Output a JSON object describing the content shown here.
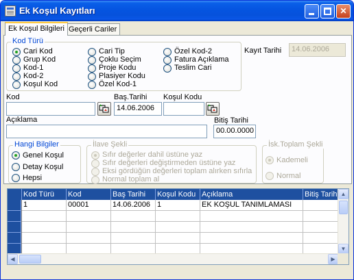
{
  "window": {
    "title": "Ek Koşul Kayıtları",
    "app_icon": "form-icon"
  },
  "tabs": [
    "Ek Koşul Bilgileri",
    "Geçerli Cariler"
  ],
  "kod_turu": {
    "title": "Kod Türü",
    "options": [
      "Cari Kod",
      "Grup Kod",
      "Kod-1",
      "Kod-2",
      "Koşul Kod",
      "Cari Tip",
      "Çoklu Seçim",
      "Proje Kodu",
      "Plasiyer Kodu",
      "Özel Kod-1",
      "Özel Kod-2",
      "Fatura Açıklama",
      "Teslim Cari"
    ],
    "selected": "Cari Kod"
  },
  "kayit_tarihi": {
    "label": "Kayıt Tarihi",
    "value": "14.06.2006"
  },
  "kod": {
    "label": "Kod",
    "value": ""
  },
  "bas_tarihi": {
    "label": "Baş.Tarihi",
    "value": "14.06.2006"
  },
  "kosul_kodu": {
    "label": "Koşul Kodu",
    "value": ""
  },
  "aciklama": {
    "label": "Açıklama",
    "value": ""
  },
  "bitis_tarihi": {
    "label": "Bitiş Tarihi",
    "value": "00.00.0000"
  },
  "hangi_bilgiler": {
    "title": "Hangi Bilgiler",
    "options": [
      "Genel Koşul",
      "Detay Koşul",
      "Hepsi"
    ],
    "selected": "Genel Koşul"
  },
  "ilave_sekli": {
    "title": "İlave Şekli",
    "options": [
      "Sıfır değerler dahil üstüne yaz",
      "Sıfır değerleri değiştirmeden üstüne yaz",
      "Eksi gördüğün değerleri toplam alırken sıfırla",
      "Normal toplam al"
    ],
    "selected": "Sıfır değerler dahil üstüne yaz"
  },
  "isk_toplam_sekli": {
    "title": "İsk.Toplam Şekli",
    "options": [
      "Kademeli",
      "Normal"
    ],
    "selected": "Kademeli"
  },
  "grid": {
    "columns": [
      "Kod Türü",
      "Kod",
      "Baş Tarihi",
      "Koşul Kodu",
      "Açıklama",
      "Bitiş Tarihi"
    ],
    "rows": [
      [
        "1",
        "00001",
        "14.06.2006",
        "1",
        "EK KOŞUL TANIMLAMASI",
        ""
      ]
    ]
  },
  "colors": {
    "accent": "#0046d5",
    "grid_header": "#1e50a0",
    "title_bar": "#0554e0"
  }
}
